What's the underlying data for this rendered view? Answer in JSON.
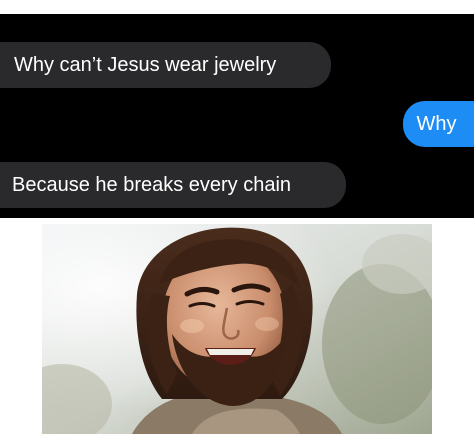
{
  "conversation": {
    "messages": [
      {
        "direction": "incoming",
        "text": "Why can’t Jesus wear jewelry"
      },
      {
        "direction": "outgoing",
        "text": "Why"
      },
      {
        "direction": "incoming",
        "text": "Because he breaks every chain"
      }
    ]
  },
  "colors": {
    "chat_background": "#000000",
    "incoming_bubble": "#2a2a2c",
    "outgoing_bubble": "#1e8cf5",
    "text": "#ffffff"
  },
  "image": {
    "icon": "laughing-man-photo"
  }
}
